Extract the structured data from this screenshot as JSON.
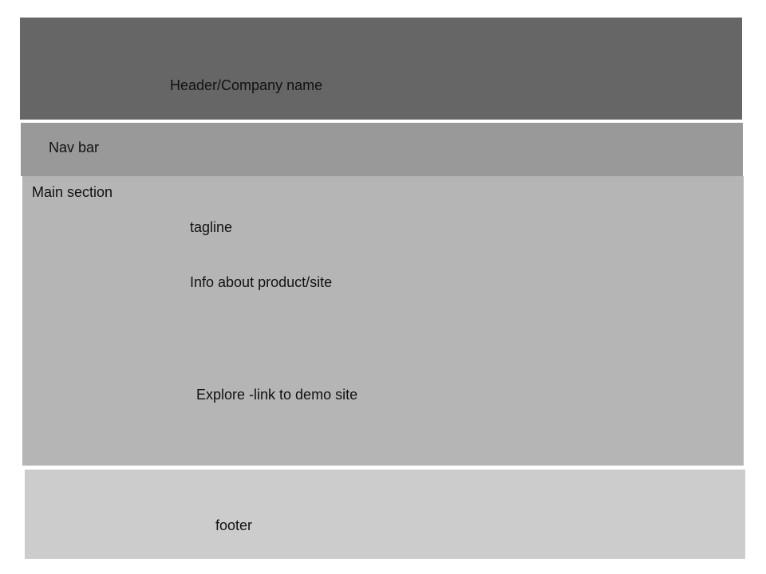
{
  "header": {
    "label": "Header/Company name",
    "color": "#666666"
  },
  "nav": {
    "label": "Nav bar",
    "color": "#999999"
  },
  "main": {
    "label": "Main section",
    "tagline": "tagline",
    "info": "Info about product/site",
    "explore": "Explore -link to demo site",
    "color": "#b5b5b5"
  },
  "footer": {
    "label": "footer",
    "color": "#cccccc"
  }
}
